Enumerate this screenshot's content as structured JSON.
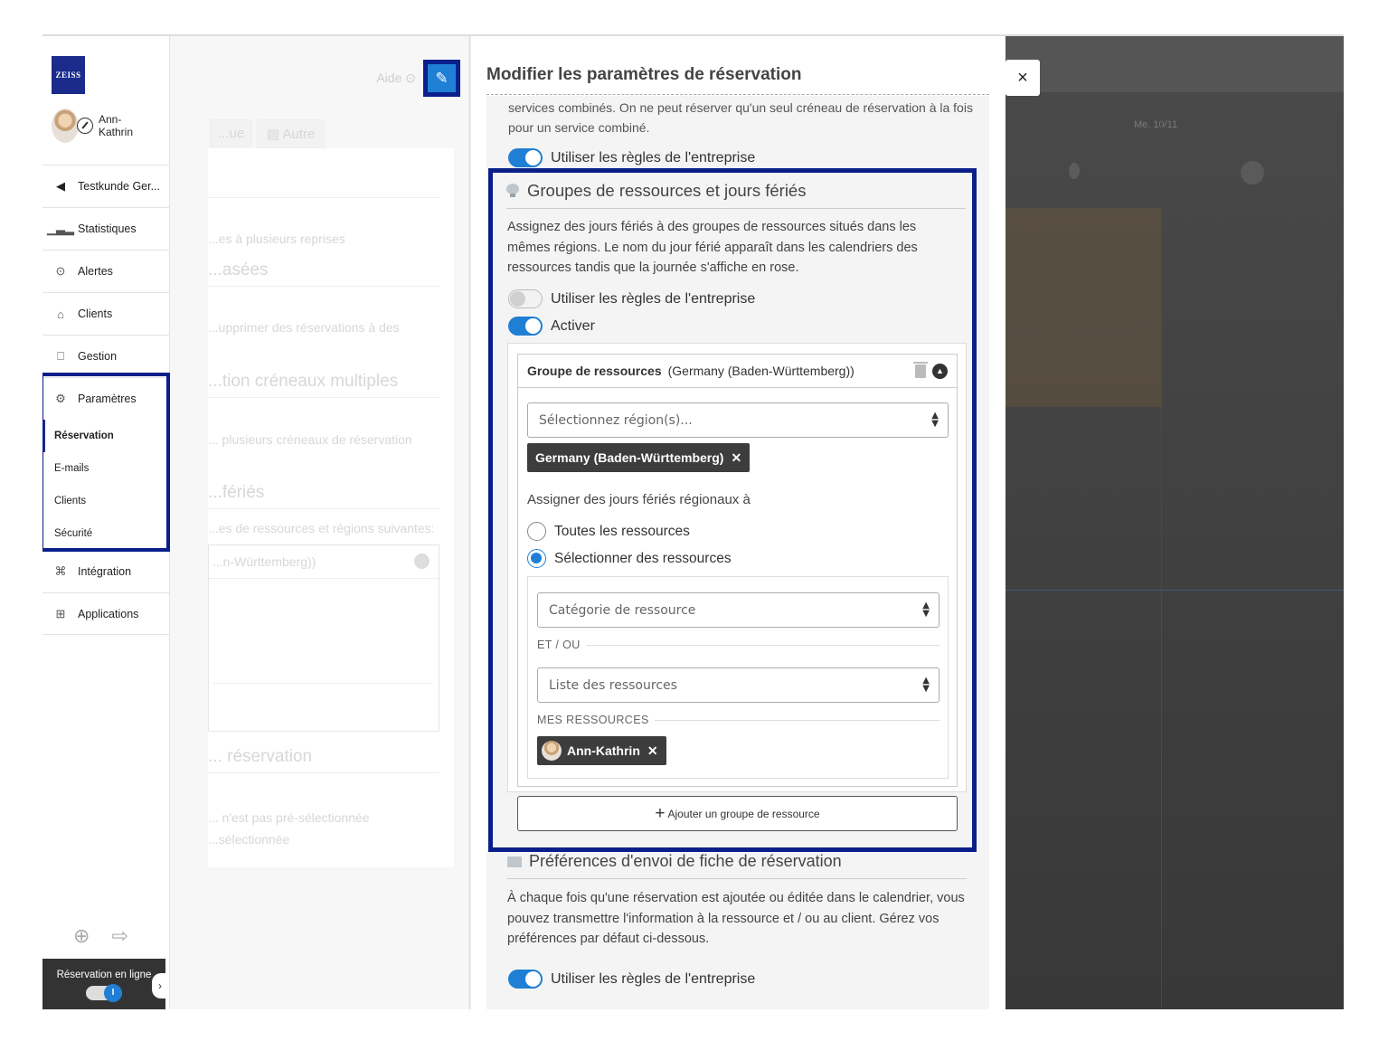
{
  "sidebar": {
    "logo_text": "ZEISS",
    "user_name": "Ann-Kathrin",
    "nav": [
      {
        "label": "Testkunde Ger...",
        "icon": "back-circle-icon"
      },
      {
        "label": "Statistiques",
        "icon": "bar-chart-icon"
      },
      {
        "label": "Alertes",
        "icon": "bell-icon"
      },
      {
        "label": "Clients",
        "icon": "user-icon"
      },
      {
        "label": "Gestion",
        "icon": "printer-icon"
      },
      {
        "label": "Paramètres",
        "icon": "gears-icon"
      }
    ],
    "sub_items": [
      "Réservation",
      "E-mails",
      "Clients",
      "Sécurité"
    ],
    "nav_after": [
      {
        "label": "Intégration",
        "icon": "integration-icon"
      },
      {
        "label": "Applications",
        "icon": "grid-icon"
      }
    ],
    "online_booking_label": "Réservation en ligne"
  },
  "middle": {
    "help_label": "Aide",
    "tab_other": "Autre",
    "tab_partial": "...ue",
    "ghost_texts": [
      "...es à plusieurs reprises",
      "...asées",
      "...upprimer des réservations à des",
      "...tion créneaux multiples",
      "... plusieurs créneaux de réservation",
      "...fériés",
      "...es de ressources et régions suivantes:",
      "...n-Württemberg))",
      "... réservation",
      "... n'est pas pré-sélectionnée",
      "...sélectionnée"
    ]
  },
  "calendar": {
    "date_label": "Me. 10/11"
  },
  "modal": {
    "title": "Modifier les paramètres de réservation",
    "close_glyph": "×",
    "prev_text": "services combinés. On ne peut réserver qu'un seul créneau de réservation à la fois pour un service combiné.",
    "prev_toggle_label": "Utiliser les règles de l'entreprise",
    "holidays": {
      "title": "Groupes de ressources et jours fériés",
      "description": "Assignez des jours fériés à des groupes de ressources situés dans les mêmes régions. Le nom du jour férié apparaît dans les calendriers des ressources tandis que la journée s'affiche en rose.",
      "toggle_company_label": "Utiliser les règles de l'entreprise",
      "toggle_enable_label": "Activer",
      "group": {
        "label": "Groupe de ressources",
        "region": "(Germany (Baden-Württemberg))",
        "region_select_placeholder": "Sélectionnez région(s)...",
        "region_tag": "Germany (Baden-Württemberg)",
        "assign_label": "Assigner des jours fériés régionaux à",
        "radio_all": "Toutes les ressources",
        "radio_select": "Sélectionner des ressources",
        "category_placeholder": "Catégorie de ressource",
        "and_or": "ET / OU",
        "resource_list_placeholder": "Liste des ressources",
        "my_resources": "MES RESSOURCES",
        "person_tag": "Ann-Kathrin"
      },
      "add_group_label": "Ajouter un groupe de ressource"
    },
    "preferences": {
      "title": "Préférences d'envoi de fiche de réservation",
      "description": "À chaque fois qu'une réservation est ajoutée ou éditée dans le calendrier, vous pouvez transmettre l'information à la ressource et / ou au client. Gérez vos préférences par défaut ci-dessous.",
      "toggle_label": "Utiliser les règles de l'entreprise"
    }
  },
  "colors": {
    "accent": "#1f7fd4",
    "highlight": "#0a1f8a",
    "logo": "#1a2b8c"
  }
}
